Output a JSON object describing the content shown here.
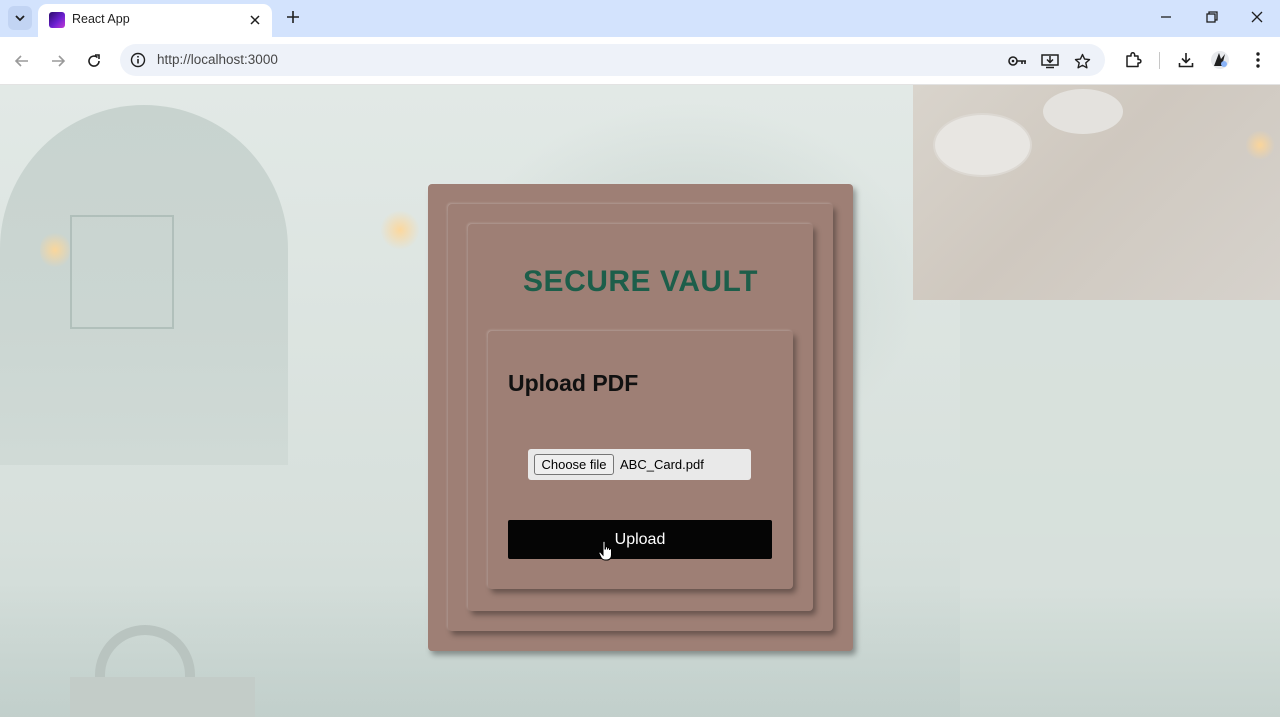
{
  "browser": {
    "tab_title": "React App",
    "url": "http://localhost:3000",
    "icons": {
      "tab_search": "chevron-down-icon",
      "tab_close": "close-icon",
      "new_tab": "plus-icon",
      "minimize": "minimize-icon",
      "restore": "restore-icon",
      "close_window": "close-icon",
      "back": "back-arrow-icon",
      "forward": "forward-arrow-icon",
      "reload": "reload-icon",
      "site_info": "info-icon",
      "password": "key-icon",
      "install": "install-app-icon",
      "bookmark": "star-icon",
      "extensions": "puzzle-icon",
      "downloads": "download-icon",
      "profile": "profile-icon",
      "menu": "kebab-menu-icon"
    }
  },
  "page": {
    "title": "SECURE VAULT",
    "upload_heading": "Upload PDF",
    "file_input": {
      "button_label": "Choose file",
      "selected_file": "ABC_Card.pdf"
    },
    "upload_button_label": "Upload",
    "colors": {
      "card": "#9e7f75",
      "title": "#1d5e4a",
      "button": "#050505"
    }
  }
}
